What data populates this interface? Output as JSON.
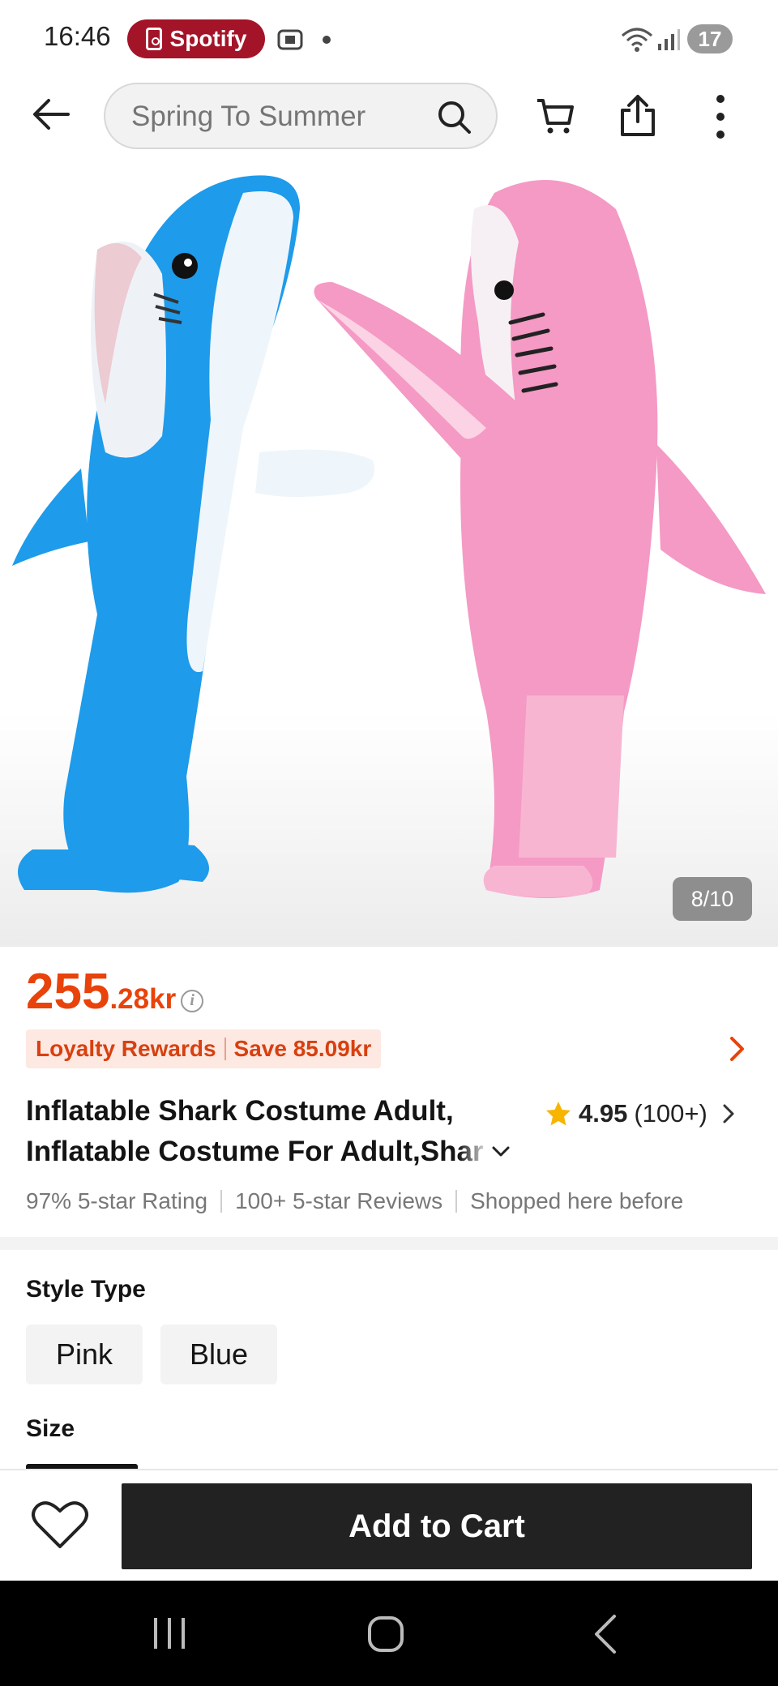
{
  "status_bar": {
    "time": "16:46",
    "app_pill": "Spotify",
    "battery": "17"
  },
  "search": {
    "placeholder": "Spring To Summer"
  },
  "icons": {
    "back": "back-arrow-icon",
    "search": "search-icon",
    "cart": "cart-icon",
    "share": "share-icon",
    "more": "more-vertical-icon",
    "heart": "heart-icon"
  },
  "gallery": {
    "counter": "8/10"
  },
  "product": {
    "price_int": "255",
    "price_dec": ".28kr",
    "loyalty_label": "Loyalty Rewards",
    "loyalty_save": "Save 85.09kr",
    "title_line1": "Inflatable Shark Costume Adult,",
    "title_line2_visible": "Inflatable Costume For Adult, ",
    "title_line2_faded": "Shar",
    "rating": "4.95",
    "rating_count": "(100+)",
    "stats": [
      "97% 5-star Rating",
      "100+ 5-star Reviews",
      "Shopped here before"
    ]
  },
  "options": {
    "style_label": "Style Type",
    "styles": [
      "Pink",
      "Blue"
    ],
    "size_label": "Size"
  },
  "actions": {
    "add_to_cart": "Add to Cart"
  },
  "colors": {
    "price": "#e8430b",
    "spotify_pill": "#a41428",
    "add_to_cart_bg": "#222222",
    "shark_blue": "#1e9bea",
    "shark_pink": "#f49ac4"
  }
}
